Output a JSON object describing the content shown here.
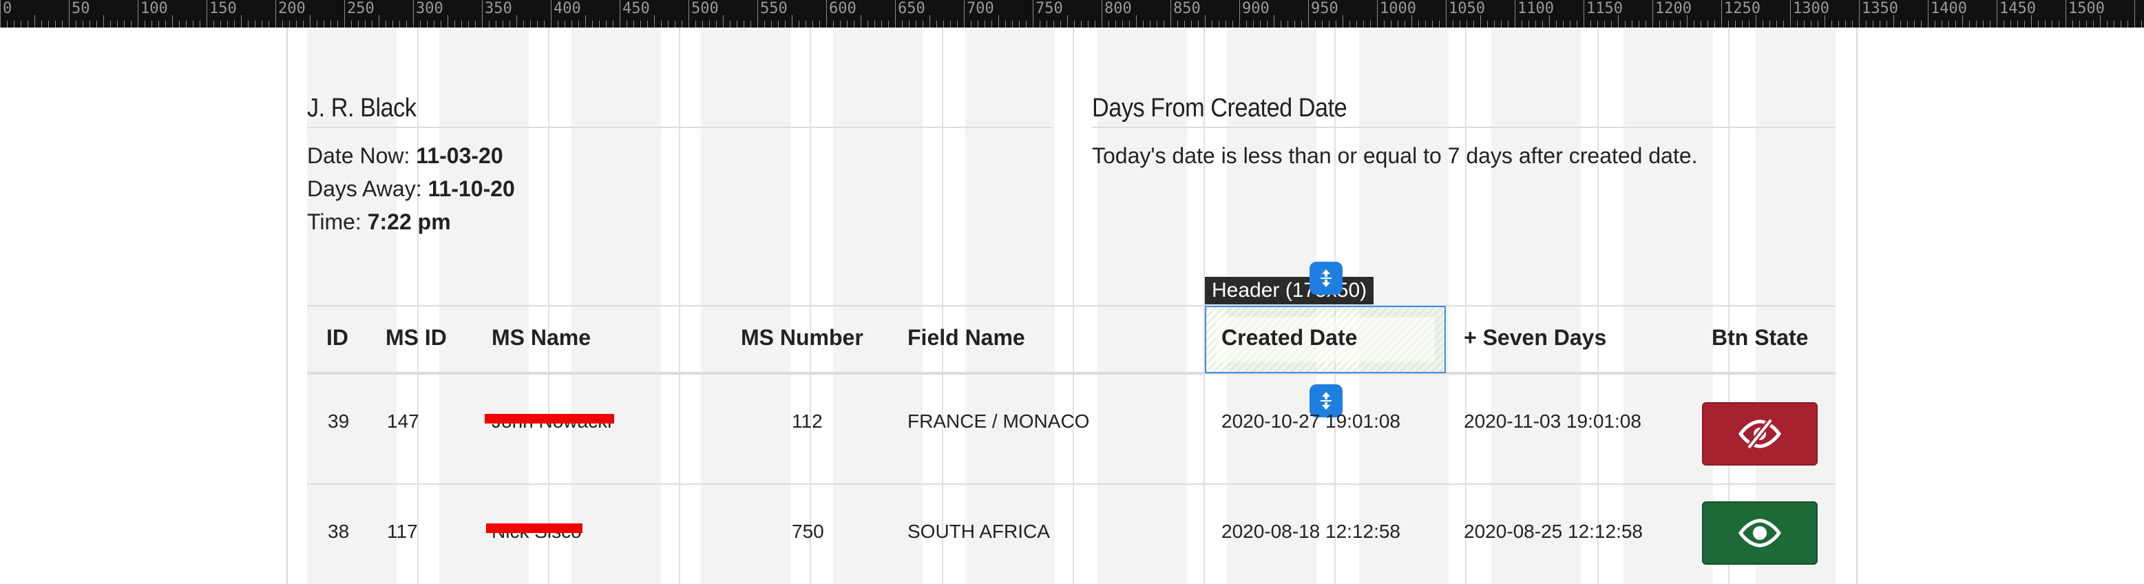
{
  "ruler": {
    "labels": [
      "0",
      "50",
      "100",
      "150",
      "200",
      "250",
      "300",
      "350",
      "400",
      "450",
      "500",
      "550",
      "600",
      "650",
      "700",
      "750",
      "800",
      "850",
      "900",
      "950",
      "1000",
      "1050",
      "1100",
      "1150",
      "1200",
      "1250",
      "1300",
      "1350",
      "1400",
      "1450",
      "1500"
    ]
  },
  "left_panel": {
    "title": "J. R. Black",
    "date_now_label": "Date Now: ",
    "date_now_value": "11-03-20",
    "days_away_label": "Days Away: ",
    "days_away_value": "11-10-20",
    "time_label": "Time: ",
    "time_value": "7:22 pm"
  },
  "right_panel": {
    "title": "Days From Created Date",
    "message": "Today's date is less than or equal to 7 days after created date."
  },
  "table": {
    "headers": {
      "id": "ID",
      "ms_id": "MS ID",
      "ms_name": "MS Name",
      "ms_number": "MS Number",
      "field_name": "Field Name",
      "created_date": "Created Date",
      "seven_days": "+ Seven Days",
      "btn_state": "Btn State"
    },
    "rows": [
      {
        "id": "39",
        "ms_id": "147",
        "ms_name": "John Nowacki",
        "ms_number": "112",
        "field_name": "FRANCE / MONACO",
        "created_date": "2020-10-27 19:01:08",
        "seven_days": "2020-11-03 19:01:08",
        "btn_icon": "eye-slash-icon",
        "btn_color": "#a7202e"
      },
      {
        "id": "38",
        "ms_id": "117",
        "ms_name": "Nick Sisco",
        "ms_number": "750",
        "field_name": "SOUTH AFRICA",
        "created_date": "2020-08-18 12:12:58",
        "seven_days": "2020-08-25 12:12:58",
        "btn_icon": "eye-icon",
        "btn_color": "#1d6a36"
      }
    ]
  },
  "inspector": {
    "label": "Header (175x50)",
    "highlight_color": "#3d8ee8"
  }
}
